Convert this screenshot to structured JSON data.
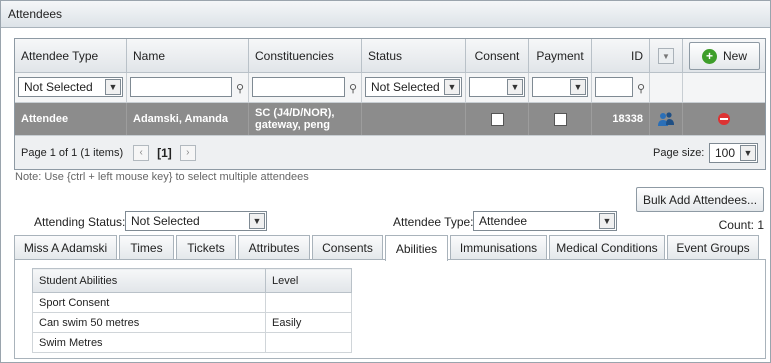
{
  "window": {
    "title": "Attendees"
  },
  "grid": {
    "columns": [
      "Attendee Type",
      "Name",
      "Constituencies",
      "Status",
      "Consent",
      "Payment",
      "ID"
    ],
    "new_button": "New",
    "filters": {
      "attendee_type": "Not Selected",
      "status": "Not Selected"
    },
    "row": {
      "attendee_type": "Attendee",
      "name": "Adamski, Amanda",
      "constituencies": "SC (J4/D/NOR), gateway, peng",
      "id": "18338"
    },
    "pager": {
      "info": "Page 1 of 1 (1 items)",
      "current": "[1]",
      "size_label": "Page size:",
      "size": "100"
    }
  },
  "note": "Note: Use {ctrl + left mouse key} to select multiple attendees",
  "bulk_button": "Bulk Add Attendees...",
  "filters": {
    "attending_status_label": "Attending Status:",
    "attending_status_value": "Not Selected",
    "attendee_type_label": "Attendee Type:",
    "attendee_type_value": "Attendee",
    "count": "Count: 1"
  },
  "tabs": [
    "Miss A Adamski",
    "Times",
    "Tickets",
    "Attributes",
    "Consents",
    "Abilities",
    "Immunisations",
    "Medical Conditions",
    "Event Groups"
  ],
  "active_tab": "Abilities",
  "abilities": {
    "headers": [
      "Student Abilities",
      "Level"
    ],
    "rows": [
      {
        "ability": "Sport Consent",
        "level": ""
      },
      {
        "ability": "Can swim 50 metres",
        "level": "Easily"
      },
      {
        "ability": "Swim Metres",
        "level": ""
      }
    ]
  }
}
